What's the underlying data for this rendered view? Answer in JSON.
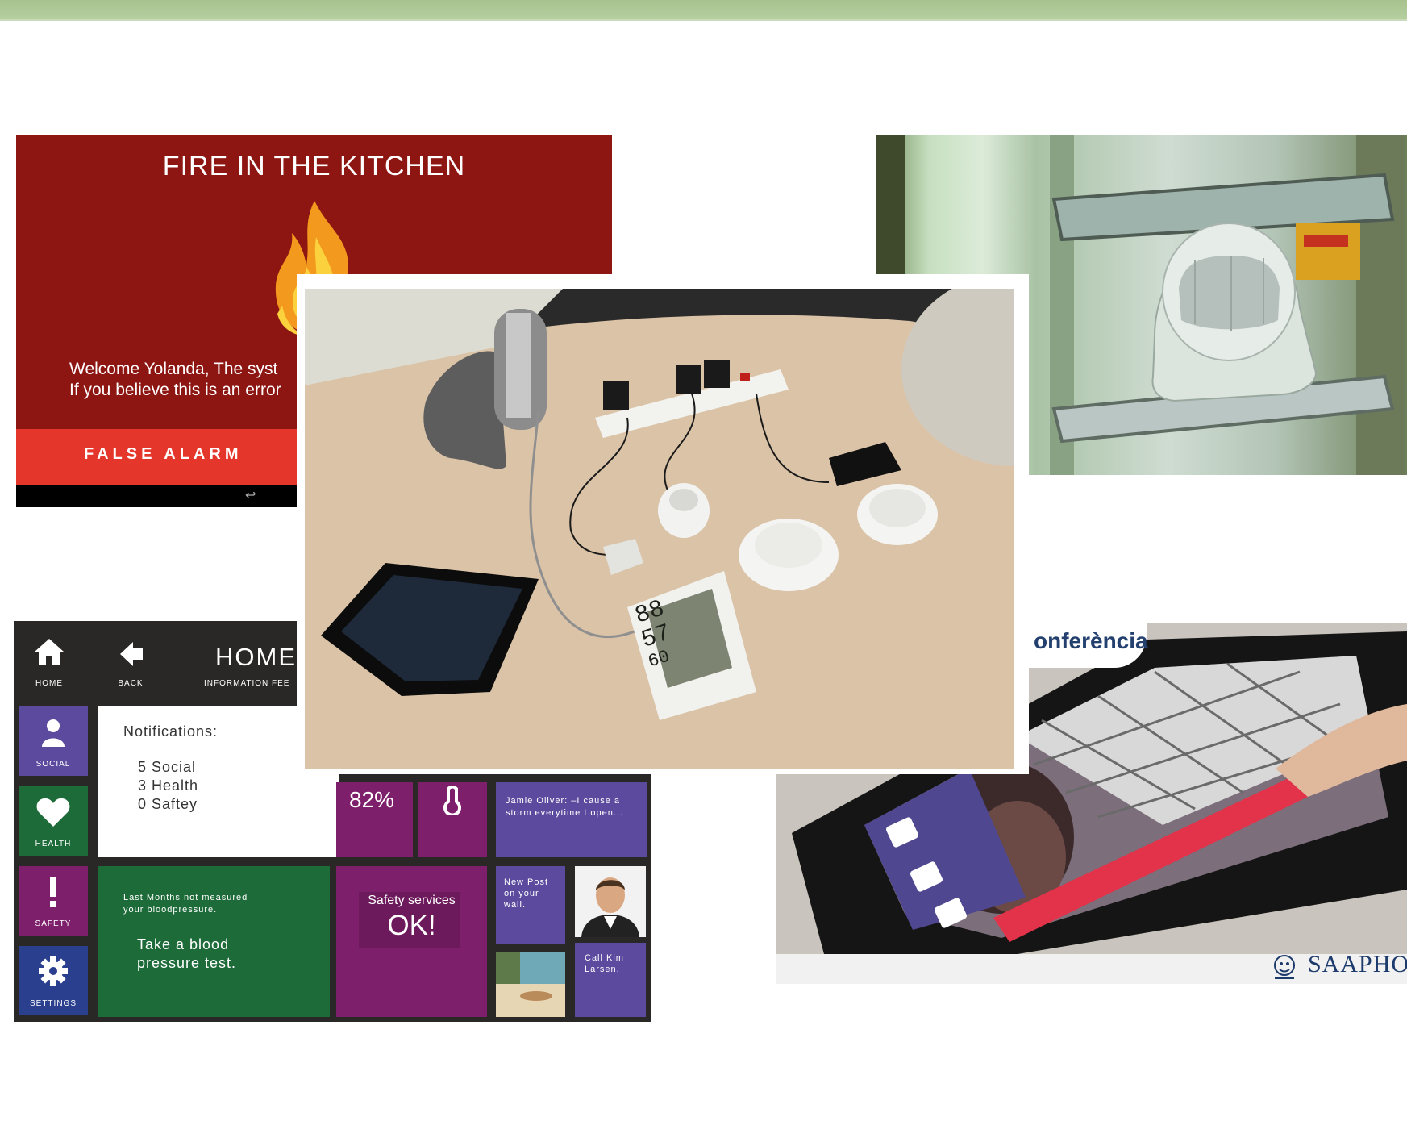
{
  "fire_alarm": {
    "title": "FIRE IN THE KITCHEN",
    "message_line1": "Welcome Yolanda, The syst",
    "message_line2": "If you believe this is an error",
    "false_alarm_button": "FALSE  ALARM",
    "back_glyph": "↩",
    "background": "#8e1612",
    "button_color": "#e4362a"
  },
  "home_dashboard": {
    "nav": {
      "home": "HOME",
      "back": "BACK",
      "title": "HOME",
      "subtitle": "INFORMATION FEE"
    },
    "sidebar": [
      {
        "label": "SOCIAL",
        "icon": "person-icon",
        "color": "#5b4a9e"
      },
      {
        "label": "HEALTH",
        "icon": "heart-icon",
        "color": "#1e6b3a"
      },
      {
        "label": "SAFETY",
        "icon": "exclamation-icon",
        "color": "#7d1f6a"
      },
      {
        "label": "SETTINGS",
        "icon": "gear-icon",
        "color": "#2a3f8e"
      }
    ],
    "notifications": {
      "heading": "Notifications:",
      "social": "5 Social",
      "health": "3 Health",
      "safety": "0 Saftey"
    },
    "humidity": "82%",
    "feed_post": "Jamie Oliver: –I cause a storm everytime I open...",
    "health_tile": {
      "line1": "Last Months not measured",
      "line2": "your bloodpressure.",
      "action_line1": "Take a blood",
      "action_line2": "pressure test."
    },
    "safety_tile": {
      "label": "Safety services",
      "status": "OK!"
    },
    "new_post": {
      "line1": "New Post",
      "line2": "on your",
      "line3": "wall."
    },
    "call": {
      "line1": "Call Kim",
      "line2": "Larsen."
    }
  },
  "devices_photo": {
    "monitor_readings": [
      "88",
      "57",
      "60"
    ]
  },
  "conference_photo": {
    "caption": "onferència",
    "brand": "SAAPHO"
  }
}
